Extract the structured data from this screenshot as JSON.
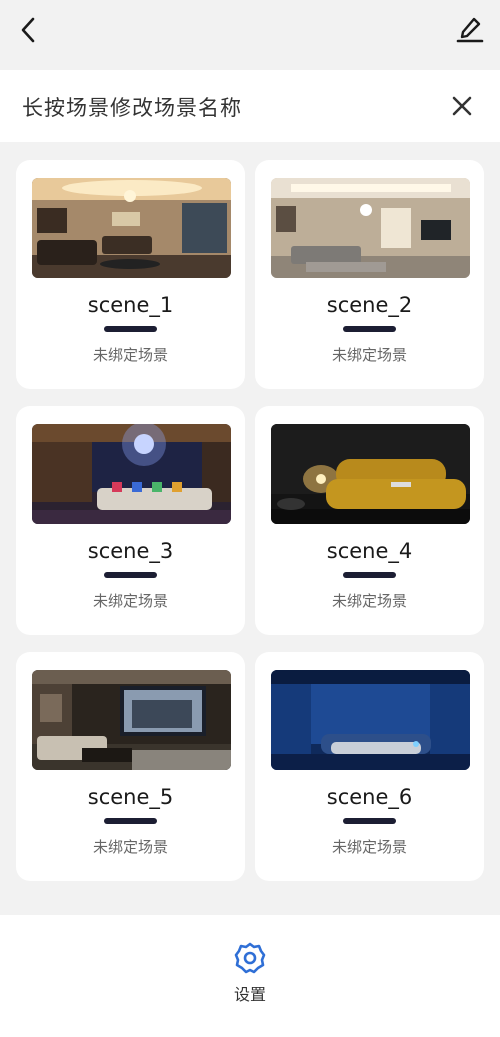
{
  "hint": {
    "text": "长按场景修改场景名称"
  },
  "scenes": [
    {
      "name": "scene_1",
      "status": "未绑定场景"
    },
    {
      "name": "scene_2",
      "status": "未绑定场景"
    },
    {
      "name": "scene_3",
      "status": "未绑定场景"
    },
    {
      "name": "scene_4",
      "status": "未绑定场景"
    },
    {
      "name": "scene_5",
      "status": "未绑定场景"
    },
    {
      "name": "scene_6",
      "status": "未绑定场景"
    }
  ],
  "bottom": {
    "settings_label": "设置"
  },
  "colors": {
    "accent": "#2f6fd6",
    "indicator": "#1c1e33"
  },
  "icons": {
    "back": "chevron-left-icon",
    "edit": "pencil-icon",
    "close": "close-icon",
    "settings": "gear-icon"
  }
}
